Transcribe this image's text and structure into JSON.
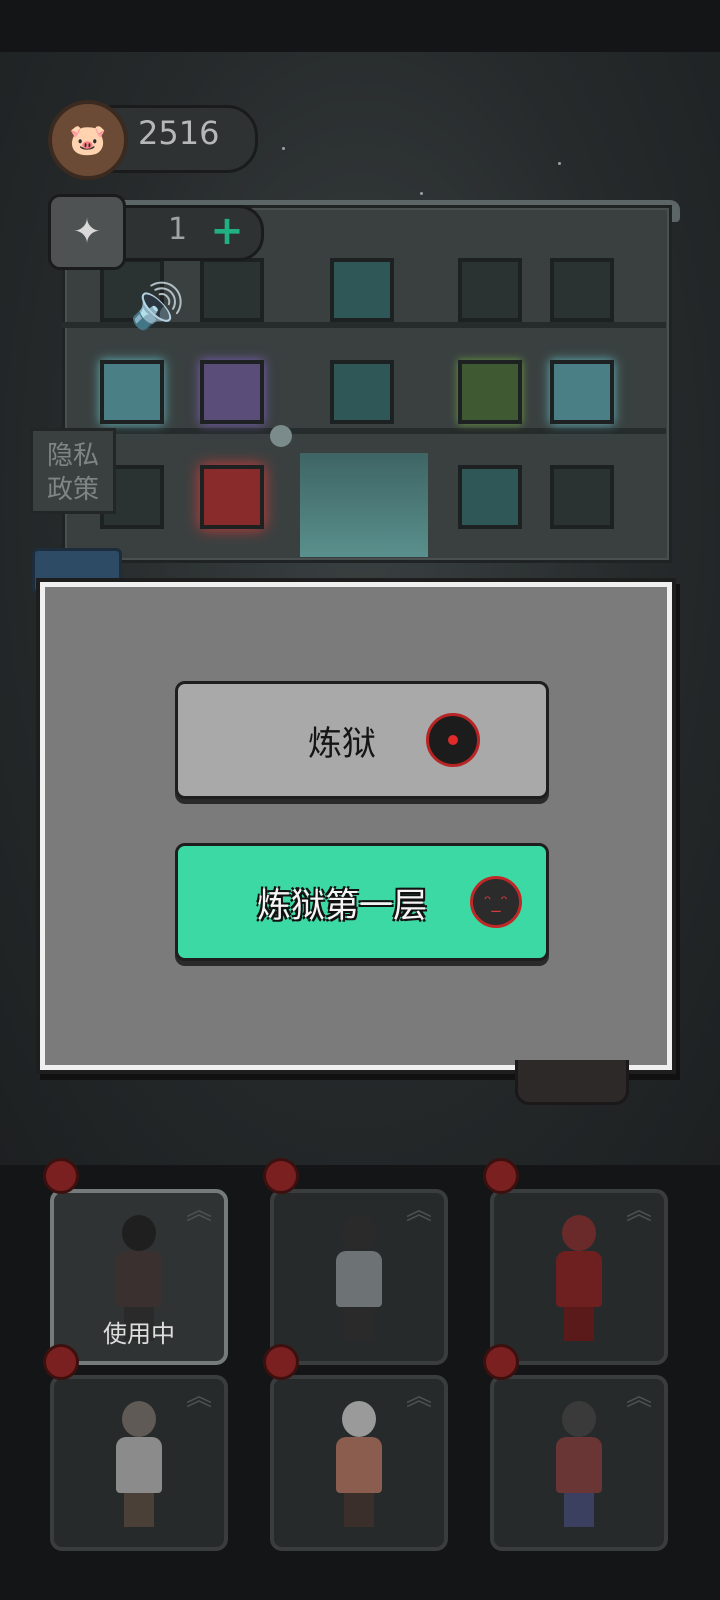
{
  "hud": {
    "coin_count": "2516",
    "coin_icon": "pig-coin-icon",
    "puzzle_count": "1",
    "puzzle_icon": "puzzle-piece-icon",
    "plus_symbol": "+",
    "sound_icon": "speaker-icon"
  },
  "privacy_policy_label": "隐私\n政策",
  "dialog": {
    "options": [
      {
        "label": "炼狱",
        "icon": "demon-avatar-icon",
        "color": "#a9a9a9"
      },
      {
        "label": "炼狱第一层",
        "icon": "demon-face-icon",
        "color": "#3dd9a5"
      }
    ]
  },
  "characters": [
    {
      "status": "使用中",
      "active": true,
      "outfit": "black-dress"
    },
    {
      "status": "",
      "active": false,
      "outfit": "grey-shirt"
    },
    {
      "status": "",
      "active": false,
      "outfit": "santa"
    },
    {
      "status": "",
      "active": false,
      "outfit": "white-shirt"
    },
    {
      "status": "",
      "active": false,
      "outfit": "grandma"
    },
    {
      "status": "",
      "active": false,
      "outfit": "red-coat"
    }
  ],
  "colors": {
    "accent_green": "#3dd9a5",
    "badge_red": "#7a2020"
  }
}
